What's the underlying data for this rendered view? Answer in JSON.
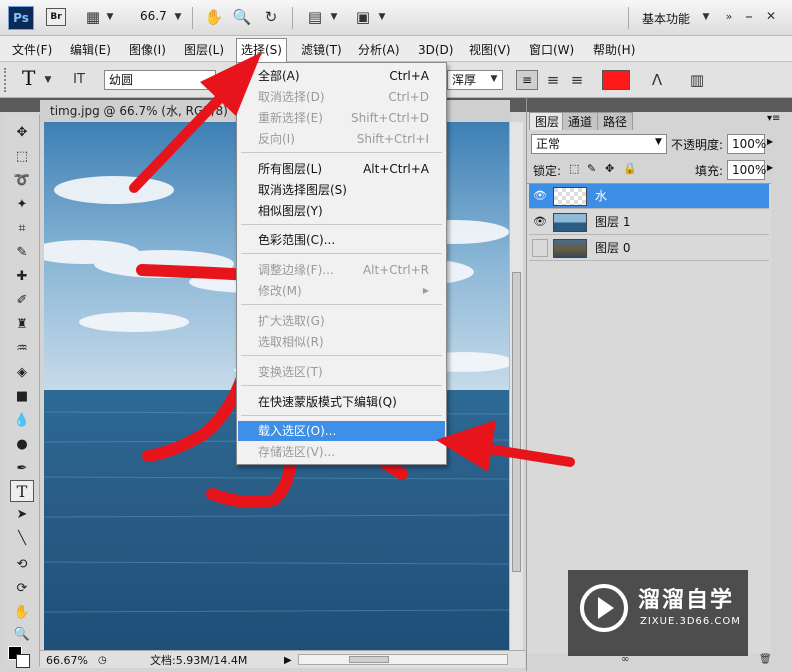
{
  "appbar": {
    "ps": "Ps",
    "br": "Br",
    "zoom": "66.7",
    "workspace": "基本功能"
  },
  "menubar": [
    "文件(F)",
    "编辑(E)",
    "图像(I)",
    "图层(L)",
    "选择(S)",
    "滤镜(T)",
    "分析(A)",
    "3D(D)",
    "视图(V)",
    "窗口(W)",
    "帮助(H)"
  ],
  "options": {
    "tool_glyph": "T",
    "font_name": "幼圆",
    "aa_value": "浑厚",
    "text_color": "#ff1a1a"
  },
  "document": {
    "tab_title": "timg.jpg @ 66.7% (水, RGB/8)",
    "status_zoom": "66.67%",
    "status_doc": "文档:5.93M/14.4M"
  },
  "select_menu": [
    {
      "label": "全部(A)",
      "shortcut": "Ctrl+A",
      "disabled": false
    },
    {
      "label": "取消选择(D)",
      "shortcut": "Ctrl+D",
      "disabled": true
    },
    {
      "label": "重新选择(E)",
      "shortcut": "Shift+Ctrl+D",
      "disabled": true
    },
    {
      "label": "反向(I)",
      "shortcut": "Shift+Ctrl+I",
      "disabled": true
    },
    {
      "label": "所有图层(L)",
      "shortcut": "Alt+Ctrl+A",
      "disabled": false
    },
    {
      "label": "取消选择图层(S)",
      "shortcut": "",
      "disabled": false
    },
    {
      "label": "相似图层(Y)",
      "shortcut": "",
      "disabled": false
    },
    {
      "label": "色彩范围(C)...",
      "shortcut": "",
      "disabled": false
    },
    {
      "label": "调整边缘(F)...",
      "shortcut": "Alt+Ctrl+R",
      "disabled": true
    },
    {
      "label": "修改(M)",
      "shortcut": "",
      "disabled": true
    },
    {
      "label": "扩大选取(G)",
      "shortcut": "",
      "disabled": true
    },
    {
      "label": "选取相似(R)",
      "shortcut": "",
      "disabled": true
    },
    {
      "label": "变换选区(T)",
      "shortcut": "",
      "disabled": true
    },
    {
      "label": "在快速蒙版模式下编辑(Q)",
      "shortcut": "",
      "disabled": false
    },
    {
      "label": "载入选区(O)...",
      "shortcut": "",
      "disabled": false,
      "highlighted": true
    },
    {
      "label": "存储选区(V)...",
      "shortcut": "",
      "disabled": true
    }
  ],
  "layers_panel": {
    "tabs": [
      "图层",
      "通道",
      "路径"
    ],
    "blend_mode": "正常",
    "opacity_label": "不透明度:",
    "opacity_value": "100%",
    "lock_label": "锁定:",
    "fill_label": "填充:",
    "fill_value": "100%",
    "layers": [
      {
        "name": "水",
        "visible": true,
        "selected": true
      },
      {
        "name": "图层 1",
        "visible": true,
        "selected": false
      },
      {
        "name": "图层 0",
        "visible": false,
        "selected": false
      }
    ]
  },
  "watermark": {
    "title": "溜溜自学",
    "url": "ZIXUE.3D66.COM"
  },
  "annotation_color": "#e8141b"
}
